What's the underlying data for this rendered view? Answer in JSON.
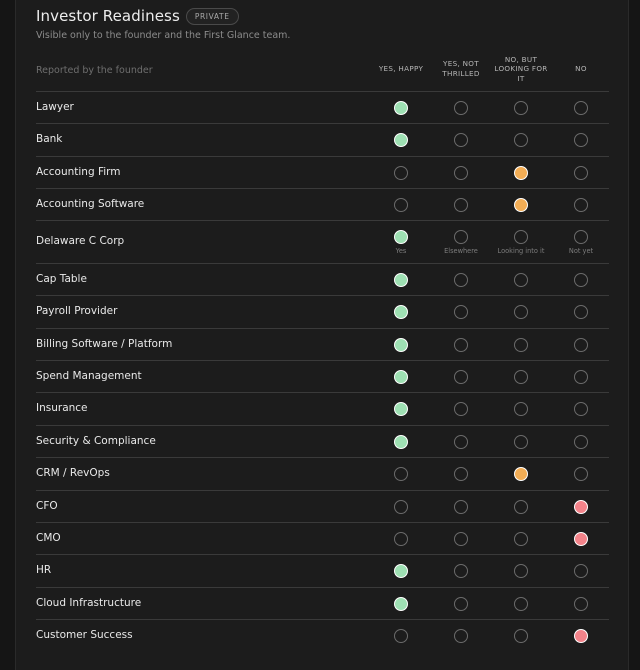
{
  "header": {
    "title": "Investor Readiness",
    "badge": "PRIVATE",
    "subtitle": "Visible only to the founder and the First Glance team.",
    "reported_by": "Reported by the founder"
  },
  "columns": [
    {
      "lines": [
        "YES, HAPPY"
      ]
    },
    {
      "lines": [
        "YES, NOT",
        "THRILLED"
      ]
    },
    {
      "lines": [
        "NO, BUT",
        "LOOKING FOR",
        "IT"
      ]
    },
    {
      "lines": [
        "NO"
      ]
    }
  ],
  "colors": {
    "yes_happy": "#9ee0b3",
    "looking": "#f2ad55",
    "no": "#f3838a",
    "unselected_border": "#6b6b6b"
  },
  "rows": [
    {
      "label": "Lawyer",
      "selected": 0
    },
    {
      "label": "Bank",
      "selected": 0
    },
    {
      "label": "Accounting Firm",
      "selected": 2
    },
    {
      "label": "Accounting Software",
      "selected": 2
    },
    {
      "label": "Delaware C Corp",
      "selected": 0,
      "sub_labels": [
        "Yes",
        "Elsewhere",
        "Looking into it",
        "Not yet"
      ]
    },
    {
      "label": "Cap Table",
      "selected": 0
    },
    {
      "label": "Payroll Provider",
      "selected": 0
    },
    {
      "label": "Billing Software / Platform",
      "selected": 0
    },
    {
      "label": "Spend Management",
      "selected": 0
    },
    {
      "label": "Insurance",
      "selected": 0
    },
    {
      "label": "Security & Compliance",
      "selected": 0
    },
    {
      "label": "CRM / RevOps",
      "selected": 2
    },
    {
      "label": "CFO",
      "selected": 3
    },
    {
      "label": "CMO",
      "selected": 3
    },
    {
      "label": "HR",
      "selected": 0
    },
    {
      "label": "Cloud Infrastructure",
      "selected": 0
    },
    {
      "label": "Customer Success",
      "selected": 3
    }
  ]
}
